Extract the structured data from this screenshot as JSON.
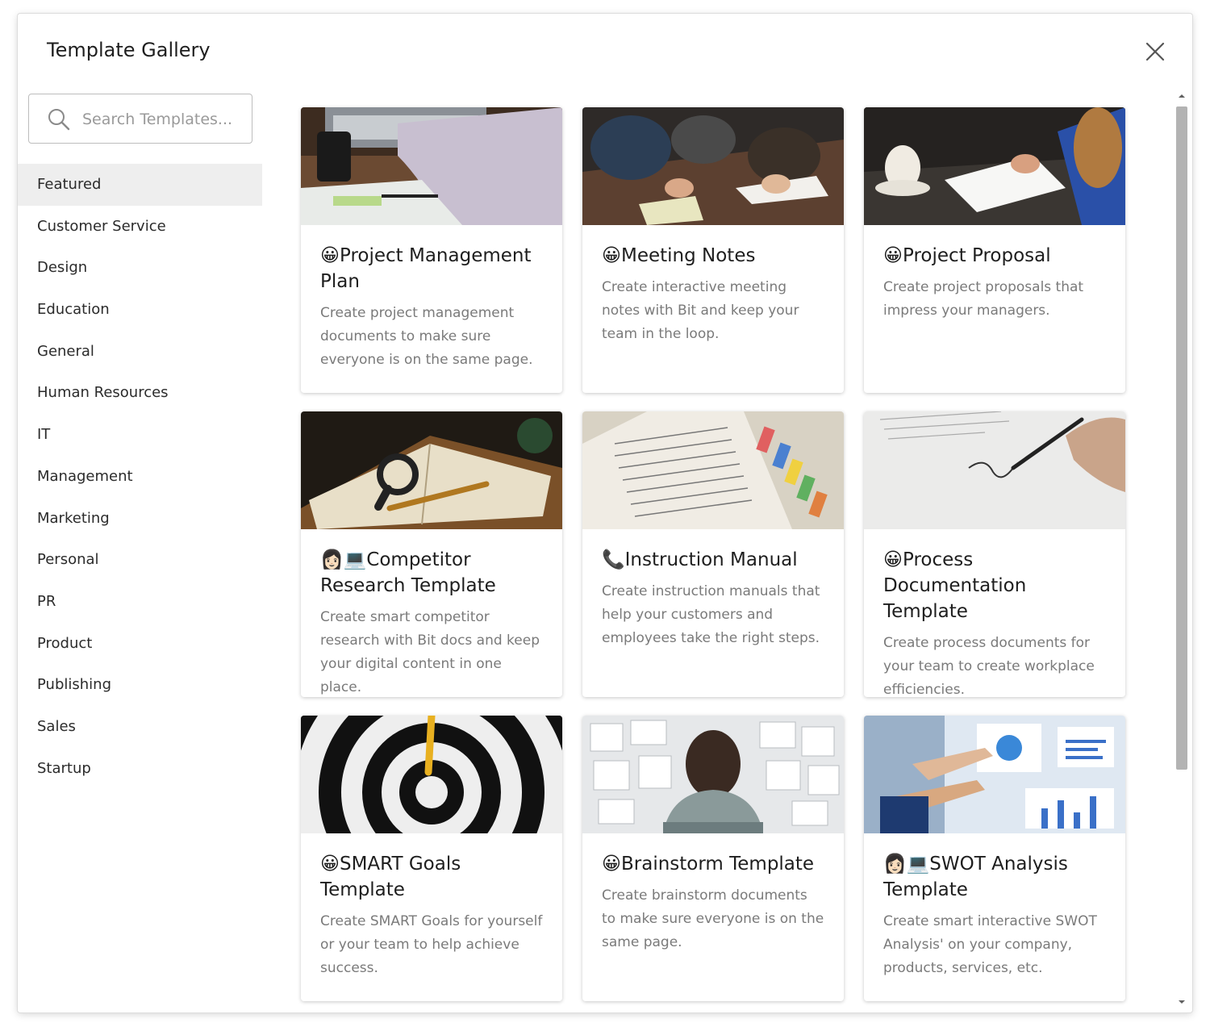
{
  "title": "Template Gallery",
  "search": {
    "placeholder": "Search Templates..."
  },
  "categories": [
    {
      "label": "Featured",
      "active": true
    },
    {
      "label": "Customer Service"
    },
    {
      "label": "Design"
    },
    {
      "label": "Education"
    },
    {
      "label": "General"
    },
    {
      "label": "Human Resources"
    },
    {
      "label": "IT"
    },
    {
      "label": "Management"
    },
    {
      "label": "Marketing"
    },
    {
      "label": "Personal"
    },
    {
      "label": "PR"
    },
    {
      "label": "Product"
    },
    {
      "label": "Publishing"
    },
    {
      "label": "Sales"
    },
    {
      "label": "Startup"
    }
  ],
  "templates": [
    {
      "emoji": "😀",
      "title": "Project Management Plan",
      "description": "Create project management documents to make sure everyone is on the same page.",
      "image": "laptop-desk-photo"
    },
    {
      "emoji": "😀",
      "title": "Meeting Notes",
      "description": "Create interactive meeting notes with Bit and keep your team in the loop.",
      "image": "meeting-table-photo"
    },
    {
      "emoji": "😀",
      "title": "Project Proposal",
      "description": "Create project proposals that impress your managers.",
      "image": "notebook-coffee-photo"
    },
    {
      "emoji": "👩🏻💻",
      "title": "Competitor Research Template",
      "description": "Create smart competitor research with Bit docs and keep your digital content in one place.",
      "image": "magnifier-book-photo"
    },
    {
      "emoji": "📞",
      "title": "Instruction Manual",
      "description": "Create instruction manuals that help your customers and employees take the right steps.",
      "image": "tabbed-book-photo"
    },
    {
      "emoji": "😀",
      "title": "Process Documentation Template",
      "description": "Create process documents for your team to create workplace efficiencies.",
      "image": "signing-document-photo"
    },
    {
      "emoji": "😀",
      "title": "SMART Goals Template",
      "description": "Create SMART Goals for yourself or your team to help achieve success.",
      "image": "dartboard-photo"
    },
    {
      "emoji": "😀",
      "title": "Brainstorm Template",
      "description": "Create brainstorm documents to make sure everyone is on the same page.",
      "image": "wall-of-sketches-photo"
    },
    {
      "emoji": "👩🏻💻",
      "title": "SWOT Analysis Template",
      "description": "Create smart interactive SWOT Analysis' on your company, products, services, etc.",
      "image": "charts-presentation-photo"
    }
  ]
}
